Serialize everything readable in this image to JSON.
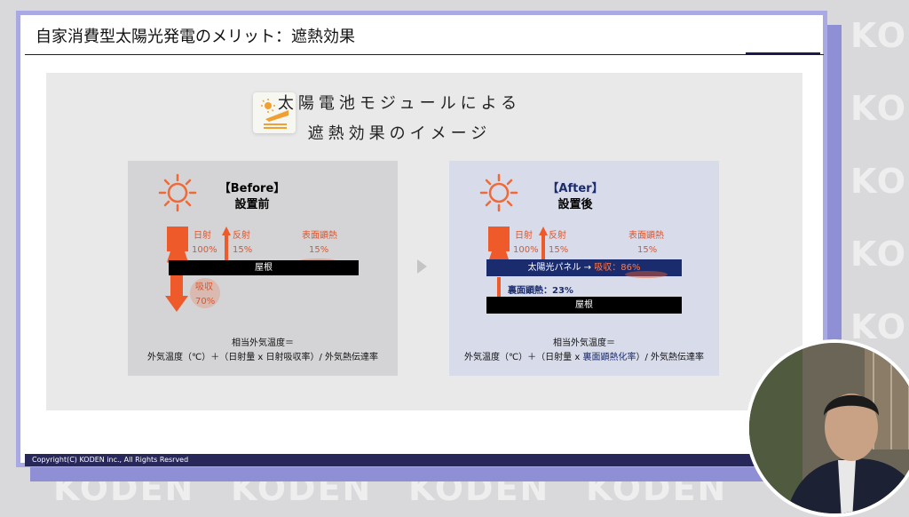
{
  "watermark": "KODEN",
  "slide": {
    "title": "自家消費型太陽光発電のメリット：遮熱効果",
    "headline_line1": "太陽電池モジュールによる",
    "headline_line2": "遮熱効果のイメージ",
    "footer": "Copyright(C) KODEN inc., All Rights Resrved"
  },
  "before": {
    "tag": "【Before】",
    "subtitle": "設置前",
    "radiation_label": "日射",
    "radiation_value": "100%",
    "reflect_label": "反射",
    "reflect_value": "15%",
    "surface_heat_label": "表面顕熱",
    "surface_heat_value": "15%",
    "roof_label": "屋根",
    "absorb_label": "吸収",
    "absorb_value": "70%",
    "formula_line1": "相当外気温度＝",
    "formula_line2": "外気温度（℃）＋（日射量 x 日射吸収率）/ 外気熱伝達率"
  },
  "after": {
    "tag": "【After】",
    "subtitle": "設置後",
    "radiation_label": "日射",
    "radiation_value": "100%",
    "reflect_label": "反射",
    "reflect_value": "15%",
    "surface_heat_label": "表面顕熱",
    "surface_heat_value": "15%",
    "panel_label": "太陽光パネル → ",
    "panel_absorb": "吸収：86%",
    "back_heat": "裏面顕熱：23%",
    "roof_label": "屋根",
    "formula_line1": "相当外気温度＝",
    "formula_line2_a": "外気温度（℃）＋（日射量 x ",
    "formula_line2_b": "裏面顕熱化率",
    "formula_line2_c": "）/ 外気熱伝達率"
  },
  "colors": {
    "accent": "#ee5a2a",
    "navy": "#1a2c6e",
    "frame": "#a9a9e3"
  }
}
